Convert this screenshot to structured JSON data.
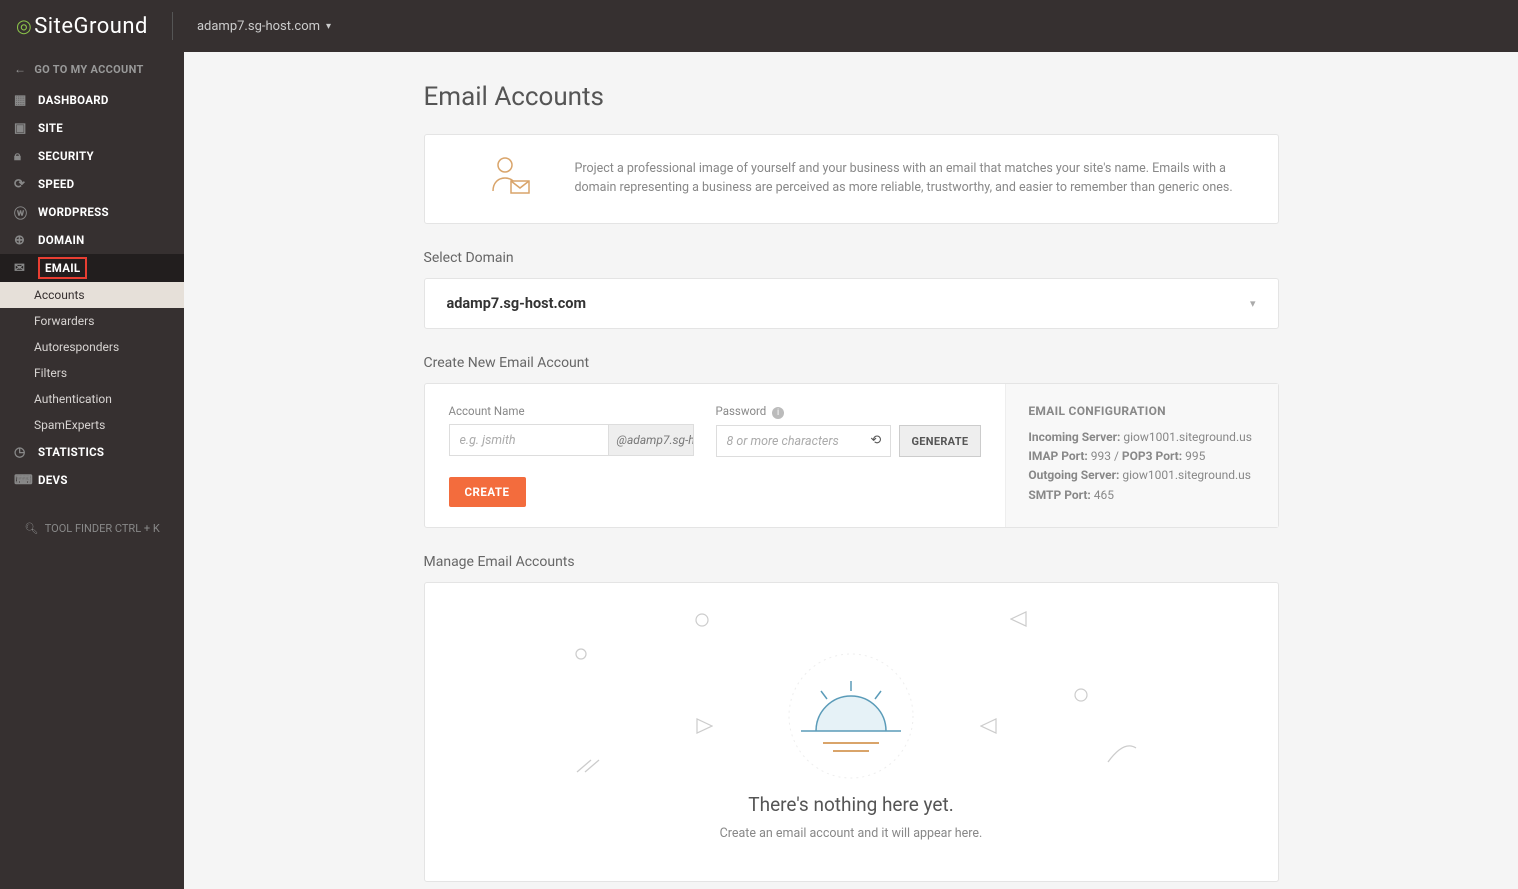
{
  "header": {
    "brand": "SiteGround",
    "domain_dropdown": "adamp7.sg-host.com"
  },
  "sidebar": {
    "back_link": "GO TO MY ACCOUNT",
    "items": [
      {
        "label": "DASHBOARD",
        "icon": "dashboard-icon"
      },
      {
        "label": "SITE",
        "icon": "site-icon"
      },
      {
        "label": "SECURITY",
        "icon": "lock-icon"
      },
      {
        "label": "SPEED",
        "icon": "speed-icon"
      },
      {
        "label": "WORDPRESS",
        "icon": "wordpress-icon"
      },
      {
        "label": "DOMAIN",
        "icon": "globe-icon"
      },
      {
        "label": "EMAIL",
        "icon": "mail-icon",
        "active": true
      },
      {
        "label": "STATISTICS",
        "icon": "stats-icon"
      },
      {
        "label": "DEVS",
        "icon": "devs-icon"
      }
    ],
    "email_sub": [
      {
        "label": "Accounts",
        "active": true
      },
      {
        "label": "Forwarders"
      },
      {
        "label": "Autoresponders"
      },
      {
        "label": "Filters"
      },
      {
        "label": "Authentication"
      },
      {
        "label": "SpamExperts"
      }
    ],
    "tool_finder": "TOOL FINDER CTRL + K"
  },
  "page": {
    "title": "Email Accounts",
    "info_text": "Project a professional image of yourself and your business with an email that matches your site's name. Emails with a domain representing a business are perceived as more reliable, trustworthy, and easier to remember than generic ones.",
    "select_domain_label": "Select Domain",
    "selected_domain": "adamp7.sg-host.com",
    "create_section_label": "Create New Email Account",
    "form": {
      "account_name_label": "Account Name",
      "account_name_placeholder": "e.g. jsmith",
      "account_name_addon": "@adamp7.sg-h...",
      "password_label": "Password",
      "password_placeholder": "8 or more characters",
      "generate_btn": "GENERATE",
      "create_btn": "CREATE"
    },
    "config": {
      "title": "EMAIL CONFIGURATION",
      "incoming_label": "Incoming Server:",
      "incoming_value": "giow1001.siteground.us",
      "imap_port_label": "IMAP Port:",
      "imap_port_value": "993",
      "pop3_port_label": "POP3 Port:",
      "pop3_port_value": "995",
      "outgoing_label": "Outgoing Server:",
      "outgoing_value": "giow1001.siteground.us",
      "smtp_port_label": "SMTP Port:",
      "smtp_port_value": "465"
    },
    "manage_section_label": "Manage Email Accounts",
    "empty_title": "There's nothing here yet.",
    "empty_sub": "Create an email account and it will appear here."
  }
}
